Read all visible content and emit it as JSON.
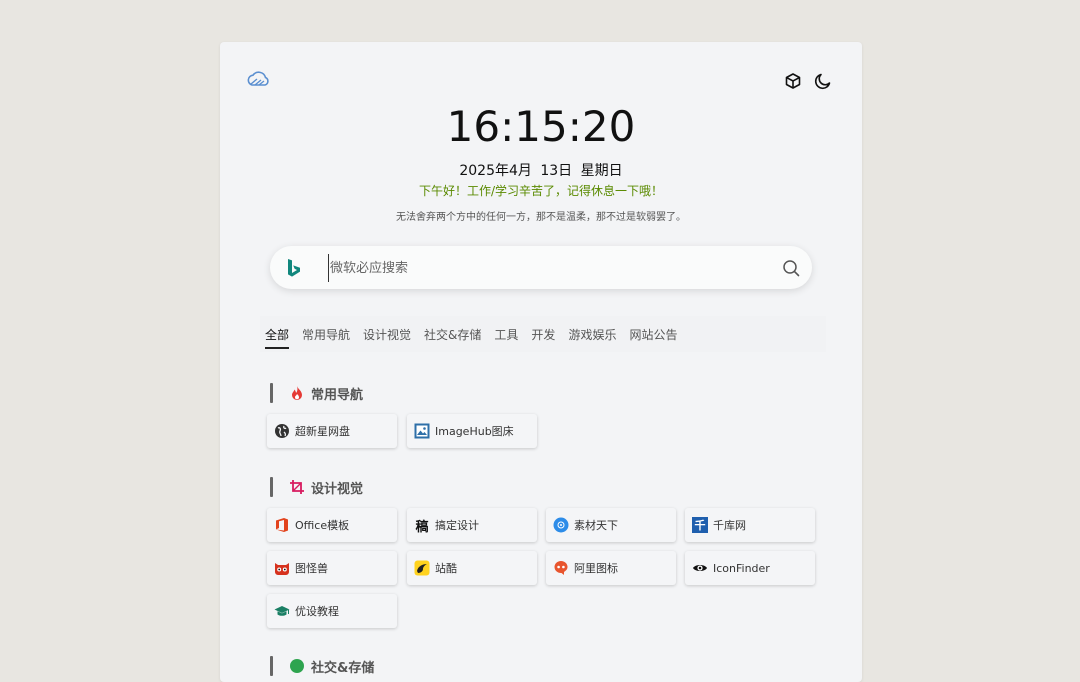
{
  "clock": {
    "time": "16:15:20"
  },
  "date": {
    "text": "2025年4月 13日 星期日"
  },
  "greeting": {
    "text": "下午好！工作/学习辛苦了，记得休息一下哦！"
  },
  "quote": {
    "text": "无法舍弃两个方中的任何一方，那不是温柔，那不过是软弱罢了。"
  },
  "search": {
    "placeholder": "微软必应搜索",
    "value": ""
  },
  "tabs": [
    {
      "label": "全部",
      "active": true
    },
    {
      "label": "常用导航"
    },
    {
      "label": "设计视觉"
    },
    {
      "label": "社交&存储"
    },
    {
      "label": "工具"
    },
    {
      "label": "开发"
    },
    {
      "label": "游戏娱乐"
    },
    {
      "label": "网站公告"
    }
  ],
  "sections": [
    {
      "title": "常用导航",
      "icon": "fire-icon",
      "items": [
        {
          "label": "超新星网盘",
          "icon": "globe-icon"
        },
        {
          "label": "ImageHub图床",
          "icon": "image-icon"
        }
      ]
    },
    {
      "title": "设计视觉",
      "icon": "crop-icon",
      "items": [
        {
          "label": "Office模板",
          "icon": "office-icon"
        },
        {
          "label": "搞定设计",
          "icon": "gaoding-icon",
          "glyph": "稿"
        },
        {
          "label": "素材天下",
          "icon": "sucai-icon"
        },
        {
          "label": "千库网",
          "icon": "qianku-icon",
          "glyph": "千"
        },
        {
          "label": "图怪兽",
          "icon": "monster-icon"
        },
        {
          "label": "站酷",
          "icon": "zcool-icon"
        },
        {
          "label": "阿里图标",
          "icon": "iconfont-icon"
        },
        {
          "label": "IconFinder",
          "icon": "eye-icon"
        },
        {
          "label": "优设教程",
          "icon": "graduation-cap-icon"
        }
      ]
    },
    {
      "title": "社交&存储",
      "icon": "social-icon",
      "items": []
    }
  ],
  "colors": {
    "background": "#e8e6e1",
    "panel": "#f3f4f6",
    "greeting": "#5a8a00",
    "bing": "#11877d",
    "fire": "#e53935",
    "crop": "#d81b60"
  }
}
